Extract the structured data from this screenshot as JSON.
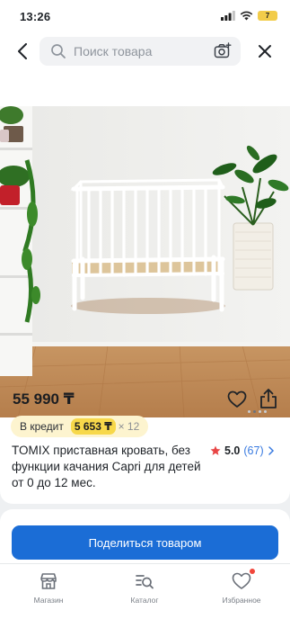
{
  "status": {
    "time": "13:26",
    "battery": "7"
  },
  "search": {
    "placeholder": "Поиск товара"
  },
  "product": {
    "price": "55 990 ₸",
    "credit_label": "В кредит",
    "credit_amount": "5 653 ₸",
    "credit_months": "× 12",
    "title": "TOMIX приставная кровать, без функции качания Capri для детей от 0 до 12 мес.",
    "rating": "5.0",
    "reviews": "(67)"
  },
  "actions": {
    "share_label": "Поделиться товаром"
  },
  "tabs": [
    {
      "label": "Магазин",
      "icon": "shop-icon"
    },
    {
      "label": "Каталог",
      "icon": "catalog-search-icon"
    },
    {
      "label": "Избранное",
      "icon": "heart-icon",
      "badge": true
    }
  ],
  "colors": {
    "accent": "#1b6dd6",
    "credit_bg": "#fdf4cf",
    "credit_highlight": "#f7d84a",
    "star": "#e84545"
  }
}
